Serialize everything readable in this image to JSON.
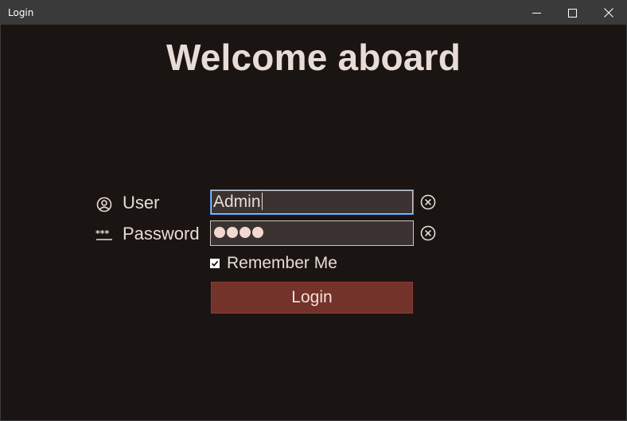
{
  "window": {
    "title": "Login",
    "controls": {
      "minimize": "minimize-icon",
      "maximize": "maximize-icon",
      "close": "close-icon"
    }
  },
  "heading": "Welcome aboard",
  "form": {
    "user": {
      "label": "User",
      "icon": "user-circle-icon",
      "value": "Admin",
      "clear_icon": "clear-circle-x-icon"
    },
    "password": {
      "label": "Password",
      "icon": "password-asterisks-icon",
      "masked_length": 4,
      "clear_icon": "clear-circle-x-icon"
    },
    "remember": {
      "label": "Remember Me",
      "checked": true
    },
    "login_button": "Login"
  },
  "colors": {
    "background": "#1a1412",
    "titlebar": "#3a3a3a",
    "text": "#e8dcd6",
    "field_bg": "#3b3331",
    "focus_border": "#4a90e2",
    "button_bg": "#73322a"
  }
}
